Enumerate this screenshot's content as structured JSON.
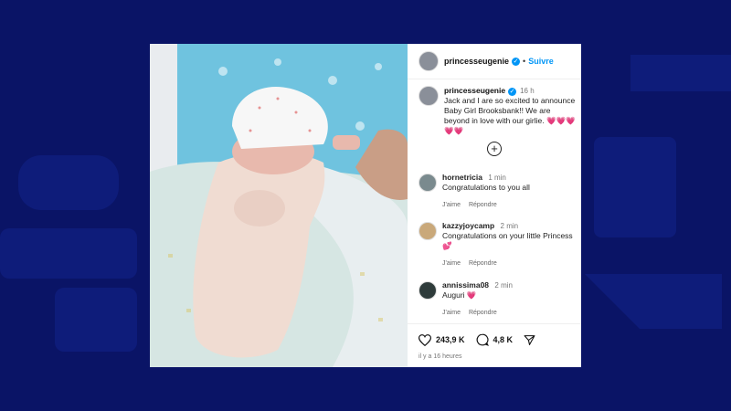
{
  "post": {
    "username": "princesseugenie",
    "follow_label": "Suivre",
    "time": "16 h",
    "caption": "Jack and I are so excited to announce Baby Girl Brooksbank!! We are beyond in love with our girlie. 💗💗💗💗💗"
  },
  "comments": [
    {
      "username": "hornetricia",
      "time": "1 min",
      "text": "Congratulations to you all",
      "like_label": "J'aime",
      "reply_label": "Répondre"
    },
    {
      "username": "kazzyjoycamp",
      "time": "2 min",
      "text": "Congratulations on your little Princess 💕",
      "like_label": "J'aime",
      "reply_label": "Répondre"
    },
    {
      "username": "annissima08",
      "time": "2 min",
      "text": "Auguri 💗",
      "like_label": "J'aime",
      "reply_label": "Répondre"
    }
  ],
  "footer": {
    "likes": "243,9 K",
    "comments_count": "4,8 K",
    "posted_ago": "il y a 16 heures"
  },
  "colors": {
    "background": "#0a1466",
    "accent": "#0095f6"
  }
}
